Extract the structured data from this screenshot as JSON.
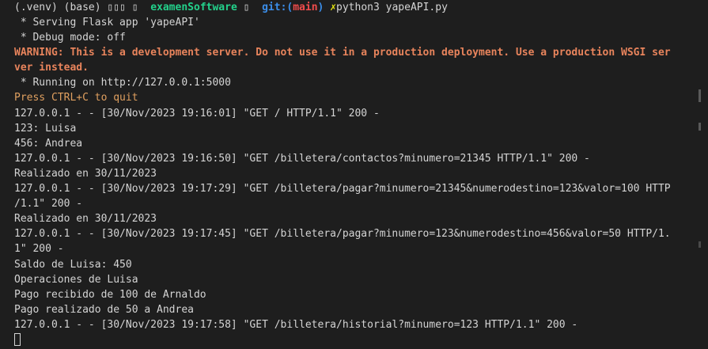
{
  "prompt": {
    "env": "(.venv) (base)",
    "glyphs": "▯▯▯ ▯",
    "directory": "examenSoftware",
    "dir_glyph": "▯",
    "git_label": "git:(",
    "branch": "main",
    "git_close": ")",
    "x_mark": "✗",
    "command": "python3 yapeAPI.py"
  },
  "output": [
    {
      "text": " * Serving Flask app 'yapeAPI'",
      "style": "normal"
    },
    {
      "text": " * Debug mode: off",
      "style": "normal"
    },
    {
      "text": "WARNING: This is a development server. Do not use it in a production deployment. Use a production WSGI ser",
      "style": "warn"
    },
    {
      "text": "ver instead.",
      "style": "warn"
    },
    {
      "text": " * Running on http://127.0.0.1:5000",
      "style": "normal"
    },
    {
      "text": "Press CTRL+C to quit",
      "style": "note"
    },
    {
      "text": "127.0.0.1 - - [30/Nov/2023 19:16:01] \"GET / HTTP/1.1\" 200 -",
      "style": "normal"
    },
    {
      "text": "123: Luisa",
      "style": "normal"
    },
    {
      "text": "456: Andrea",
      "style": "normal"
    },
    {
      "text": "127.0.0.1 - - [30/Nov/2023 19:16:50] \"GET /billetera/contactos?minumero=21345 HTTP/1.1\" 200 -",
      "style": "normal"
    },
    {
      "text": "Realizado en 30/11/2023",
      "style": "normal"
    },
    {
      "text": "127.0.0.1 - - [30/Nov/2023 19:17:29] \"GET /billetera/pagar?minumero=21345&numerodestino=123&valor=100 HTTP",
      "style": "normal"
    },
    {
      "text": "/1.1\" 200 -",
      "style": "normal"
    },
    {
      "text": "Realizado en 30/11/2023",
      "style": "normal"
    },
    {
      "text": "127.0.0.1 - - [30/Nov/2023 19:17:45] \"GET /billetera/pagar?minumero=123&numerodestino=456&valor=50 HTTP/1.",
      "style": "normal"
    },
    {
      "text": "1\" 200 -",
      "style": "normal"
    },
    {
      "text": "Saldo de Luisa: 450",
      "style": "normal"
    },
    {
      "text": "Operaciones de Luisa",
      "style": "normal"
    },
    {
      "text": "Pago recibido de 100 de Arnaldo",
      "style": "normal"
    },
    {
      "text": "Pago realizado de 50 a Andrea",
      "style": "normal"
    },
    {
      "text": "127.0.0.1 - - [30/Nov/2023 19:17:58] \"GET /billetera/historial?minumero=123 HTTP/1.1\" 200 -",
      "style": "normal"
    }
  ],
  "colors": {
    "background": "#1e1e1e",
    "foreground": "#d4d4d4",
    "warning": "#e8845c",
    "directory": "#23d18b",
    "git": "#3b8eea",
    "branch": "#f14c4c"
  }
}
